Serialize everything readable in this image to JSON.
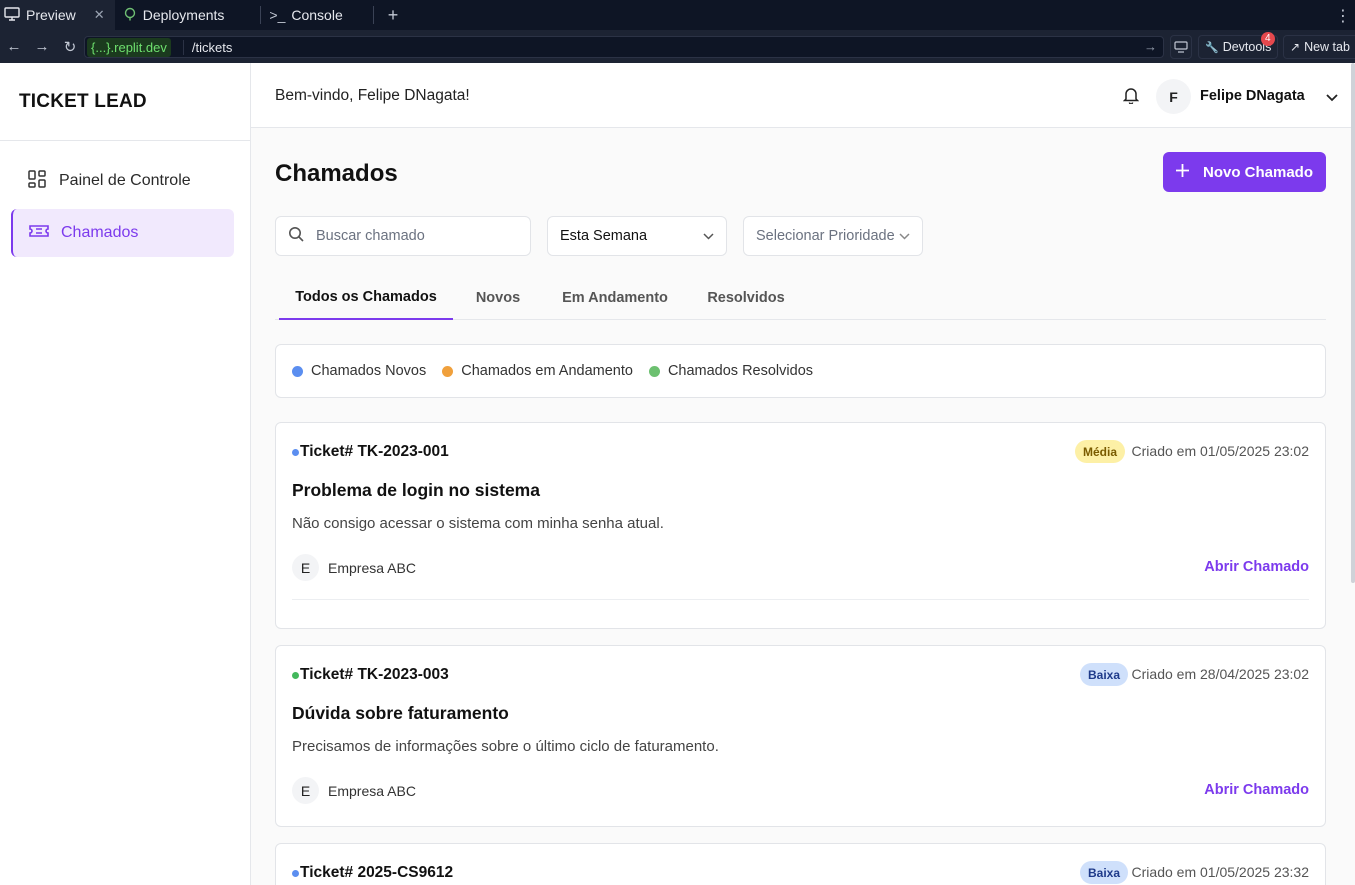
{
  "browser": {
    "tabs": [
      {
        "label": "Preview",
        "icon": "monitor-icon"
      },
      {
        "label": "Deployments",
        "icon": "deploy-icon"
      },
      {
        "label": "Console",
        "icon": "terminal-icon"
      }
    ],
    "url_host": "{...}.replit.dev",
    "url_path": "/tickets",
    "devtools_label": "Devtools",
    "devtools_badge": "4",
    "newtab_label": "New tab"
  },
  "app": {
    "logo": "TICKET LEAD",
    "accent": "#7c3aed"
  },
  "sidebar": {
    "items": [
      {
        "label": "Painel de Controle",
        "icon": "dashboard-icon",
        "active": false
      },
      {
        "label": "Chamados",
        "icon": "ticket-icon",
        "active": true
      }
    ]
  },
  "header": {
    "welcome": "Bem-vindo, Felipe DNagata!",
    "avatar_initial": "F",
    "user_name": "Felipe DNagata"
  },
  "main": {
    "title": "Chamados",
    "new_button": "Novo Chamado",
    "search_placeholder": "Buscar chamado",
    "period_select": "Esta Semana",
    "priority_select": "Selecionar Prioridade",
    "tabs": [
      "Todos os Chamados",
      "Novos",
      "Em Andamento",
      "Resolvidos"
    ],
    "legend": [
      {
        "label": "Chamados Novos",
        "color": "#5b8ef0"
      },
      {
        "label": "Chamados em Andamento",
        "color": "#f0a03c"
      },
      {
        "label": "Chamados Resolvidos",
        "color": "#6cc070"
      }
    ]
  },
  "tickets": [
    {
      "id": "Ticket# TK-2023-001",
      "status_color": "#5b8ef0",
      "priority": "Média",
      "priority_bg": "#fdf0a6",
      "priority_fg": "#7a5b00",
      "created": "Criado em 01/05/2025 23:02",
      "title": "Problema de login no sistema",
      "description": "Não consigo acessar o sistema com minha senha atual.",
      "company_initial": "E",
      "company": "Empresa ABC",
      "action": "Abrir Chamado"
    },
    {
      "id": "Ticket# TK-2023-003",
      "status_color": "#43b85c",
      "priority": "Baixa",
      "priority_bg": "#cfe0fb",
      "priority_fg": "#1e3a8a",
      "created": "Criado em 28/04/2025 23:02",
      "title": "Dúvida sobre faturamento",
      "description": "Precisamos de informações sobre o último ciclo de faturamento.",
      "company_initial": "E",
      "company": "Empresa ABC",
      "action": "Abrir Chamado"
    },
    {
      "id": "Ticket# 2025-CS9612",
      "status_color": "#5b8ef0",
      "priority": "Baixa",
      "priority_bg": "#cfe0fb",
      "priority_fg": "#1e3a8a",
      "created": "Criado em 01/05/2025 23:32"
    }
  ]
}
